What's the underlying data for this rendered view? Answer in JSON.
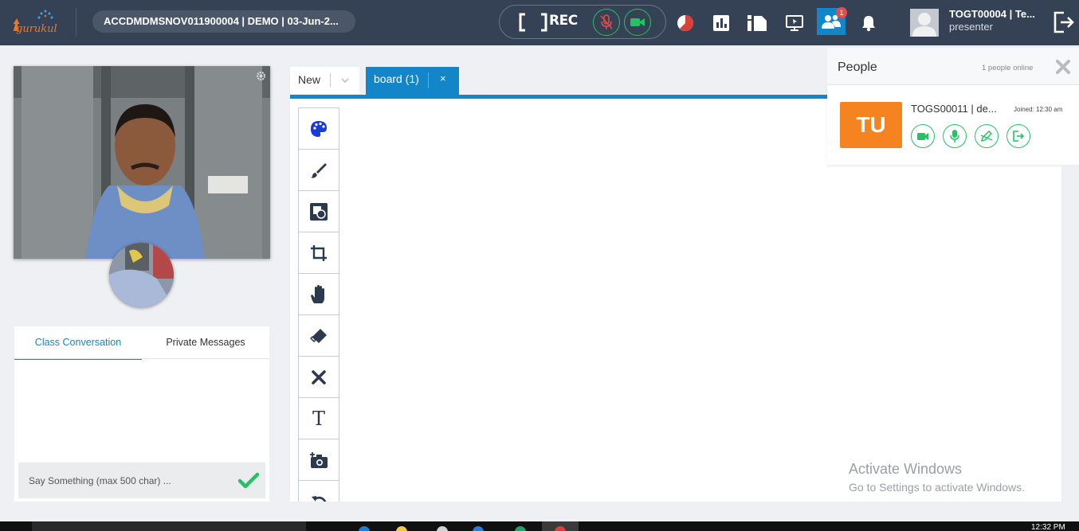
{
  "header": {
    "logo_text": "gurukul",
    "session_title": "ACCDMDMSNOV011900004 | DEMO | 03-Jun-2...",
    "rec_label": "REC",
    "people_badge": "1",
    "user_name": "TOGT00004 | Te...",
    "user_role": "presenter",
    "icons": [
      "gurukul-logo",
      "screen-record-icon",
      "mic-off-icon",
      "video-camera-icon",
      "timer-pie-icon",
      "poll-chart-icon",
      "info-panel-icon",
      "screen-share-icon",
      "people-icon",
      "bell-icon",
      "user-avatar",
      "logout-icon"
    ]
  },
  "chat": {
    "tab_class": "Class Conversation",
    "tab_private": "Private Messages",
    "input_placeholder": "Say Something (max 500 char) ..."
  },
  "board": {
    "tab_new_label": "New",
    "tab_board_label": "board (1)",
    "tab_close": "×",
    "tools": [
      "palette-icon",
      "brush-icon",
      "shapes-icon",
      "crop-icon",
      "hand-pan-icon",
      "eraser-icon",
      "clear-x-icon",
      "text-icon",
      "add-image-icon",
      "undo-icon"
    ],
    "text_tool_glyph": "T"
  },
  "people": {
    "title": "People",
    "online_count": "1 people online",
    "participants": [
      {
        "initials": "TU",
        "name": "TOGS00011 | de...",
        "joined": "Joined: 12:30 am",
        "avatar_color": "#f5831f"
      }
    ]
  },
  "watermark": {
    "title": "Activate Windows",
    "subtitle": "Go to Settings to activate Windows."
  },
  "taskbar": {
    "clock": "12:32 PM"
  },
  "colors": {
    "topbar": "#354255",
    "accent_blue": "#1286c8",
    "green": "#27c165",
    "orange": "#f5831f"
  }
}
